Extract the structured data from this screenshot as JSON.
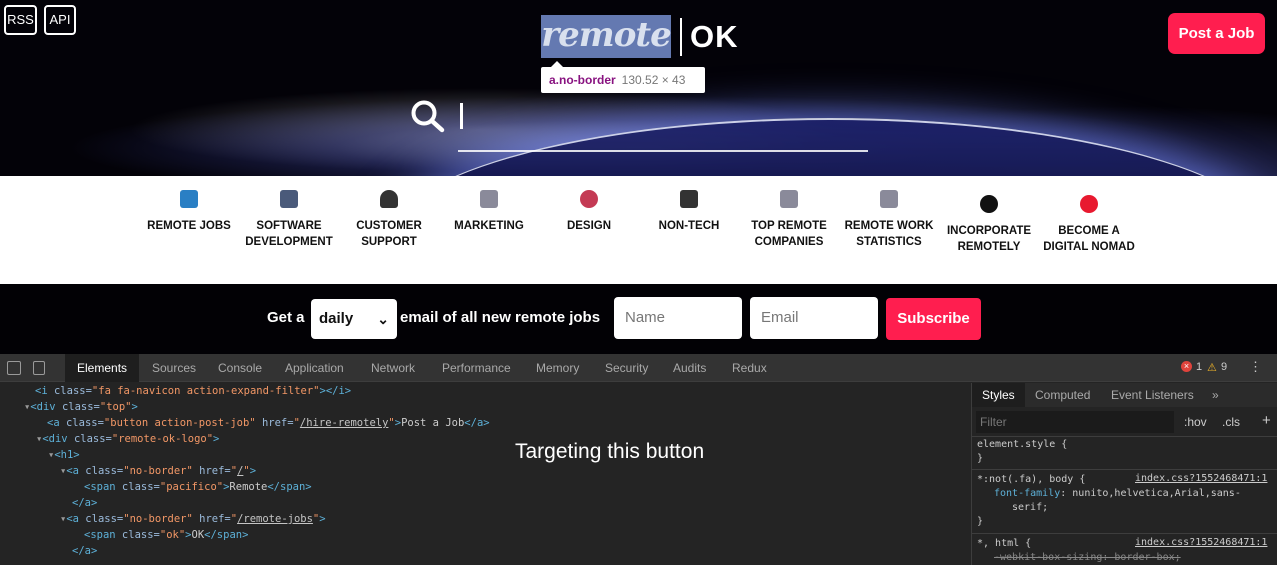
{
  "hero": {
    "rss_label": "RSS",
    "api_label": "API",
    "post_job_label": "Post a Job",
    "logo_remote": "remote",
    "logo_ok": "OK",
    "tooltip_selector": "a.no-border",
    "tooltip_size": "130.52 × 43",
    "search_value": ""
  },
  "categories": [
    {
      "label": "REMOTE JOBS",
      "icon": "beach-icon",
      "color": "#2a7fc4"
    },
    {
      "label": "SOFTWARE DEVELOPMENT",
      "icon": "laptop-icon",
      "color": "#4a5a7a"
    },
    {
      "label": "CUSTOMER SUPPORT",
      "icon": "headphones-icon",
      "color": "#333333"
    },
    {
      "label": "MARKETING",
      "icon": "chart-icon",
      "color": "#8a8a9a"
    },
    {
      "label": "DESIGN",
      "icon": "palette-icon",
      "color": "#c43a54"
    },
    {
      "label": "NON-TECH",
      "icon": "plug-icon",
      "color": "#333333"
    },
    {
      "label": "TOP REMOTE COMPANIES",
      "icon": "chart-icon",
      "color": "#8a8a9a"
    },
    {
      "label": "REMOTE WORK STATISTICS",
      "icon": "chart-icon",
      "color": "#8a8a9a"
    },
    {
      "label": "INCORPORATE REMOTELY",
      "icon": "incorporate-icon",
      "color": "#111111"
    },
    {
      "label": "BECOME A DIGITAL NOMAD",
      "icon": "nomad-icon",
      "color": "#e8192f"
    }
  ],
  "subscribe": {
    "prefix": "Get a",
    "frequency": "daily",
    "middle": "email of all new remote jobs",
    "name_placeholder": "Name",
    "email_placeholder": "Email",
    "button": "Subscribe"
  },
  "devtools": {
    "tabs": [
      "Elements",
      "Sources",
      "Console",
      "Application",
      "Network",
      "Performance",
      "Memory",
      "Security",
      "Audits",
      "Redux"
    ],
    "errors": "1",
    "warnings": "9",
    "targeting_note": "Targeting this button",
    "lines": {
      "l1_tag": "<i",
      "l1_attr": " class=",
      "l1_val": "\"fa fa-navicon action-expand-filter\"",
      "l1_end": "></i>",
      "l2_tag": "<div",
      "l2_attr": " class=",
      "l2_val": "\"top\"",
      "l2_end": ">",
      "l3_tag": "<a",
      "l3_attr1": " class=",
      "l3_val1": "\"button action-post-job\"",
      "l3_attr2": " href=",
      "l3_href": "/hire-remotely",
      "l3_text": "Post a Job",
      "l3_close": "</a>",
      "l4_tag": "<div",
      "l4_attr": " class=",
      "l4_val": "\"remote-ok-logo\"",
      "l5_tag": "<h1>",
      "l6_tag": "<a",
      "l6_attr1": " class=",
      "l6_val1": "\"no-border\"",
      "l6_attr2": " href=",
      "l6_href": "/",
      "l7_tag": "<span",
      "l7_attr": " class=",
      "l7_val": "\"pacifico\"",
      "l7_text": "Remote",
      "l7_close": "</span>",
      "l8_close": "</a>",
      "l9_tag": "<a",
      "l9_attr1": " class=",
      "l9_val1": "\"no-border\"",
      "l9_attr2": " href=",
      "l9_href": "/remote-jobs",
      "l10_tag": "<span",
      "l10_attr": " class=",
      "l10_val": "\"ok\"",
      "l10_text": "OK",
      "l10_close": "</span>",
      "l11_close": "</a>"
    },
    "styles": {
      "tabs": [
        "Styles",
        "Computed",
        "Event Listeners"
      ],
      "filter_placeholder": "Filter",
      "hov": ":hov",
      "cls": ".cls",
      "rule1": "element.style {",
      "rule1_end": "}",
      "rule2_sel": "*:not(.fa), body {",
      "rule2_src": "index.css?1552468471:1",
      "rule2_prop": "font-family",
      "rule2_val": ": nunito,helvetica,Arial,sans-",
      "rule2_val2": "serif;",
      "rule2_end": "}",
      "rule3_sel": "*, html {",
      "rule3_src": "index.css?1552468471:1",
      "rule3_prop": "-webkit-box-sizing: border-box;"
    }
  }
}
